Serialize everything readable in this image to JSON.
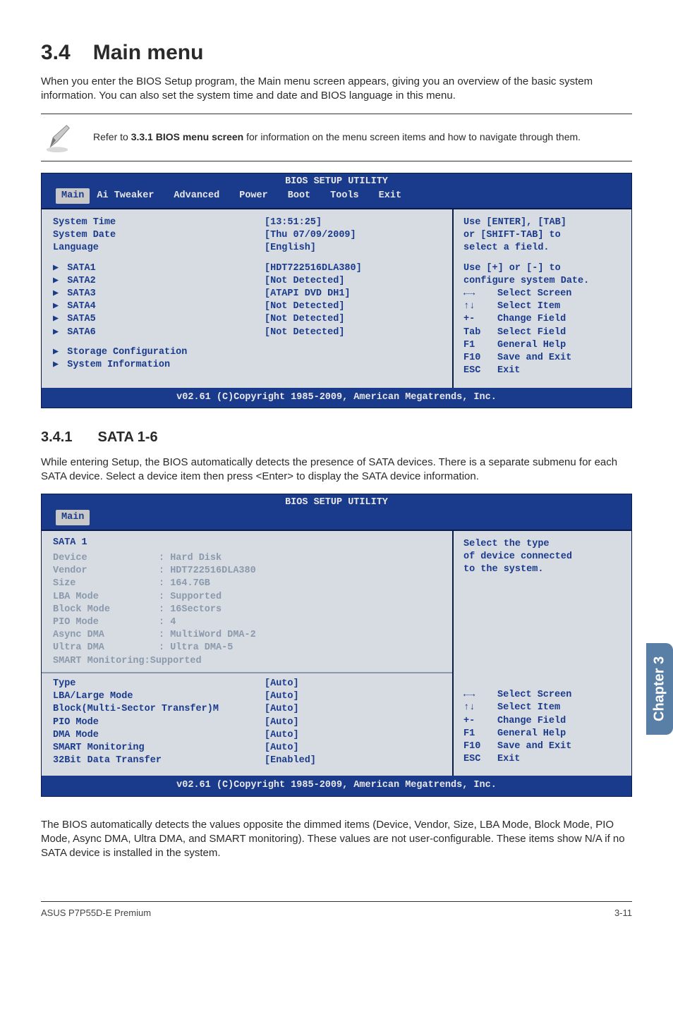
{
  "header": {
    "section_number": "3.4",
    "section_title": "Main menu",
    "intro": "When you enter the BIOS Setup program, the Main menu screen appears, giving you an overview of the basic system information. You can also set the system time and date and BIOS language in this menu.",
    "note_prefix": "Refer to ",
    "note_bold": "3.3.1 BIOS menu screen",
    "note_suffix": " for information on the menu screen items and how to navigate through them."
  },
  "bios1": {
    "title": "BIOS SETUP UTILITY",
    "tabs": [
      "Main",
      "Ai Tweaker",
      "Advanced",
      "Power",
      "Boot",
      "Tools",
      "Exit"
    ],
    "active_tab": "Main",
    "rows": [
      {
        "label": "System Time",
        "value": "[13:51:25]"
      },
      {
        "label": "System Date",
        "value": "[Thu 07/09/2009]"
      },
      {
        "label": "Language",
        "value": "[English]"
      }
    ],
    "sata_rows": [
      {
        "label": "SATA1",
        "value": "[HDT722516DLA380]"
      },
      {
        "label": "SATA2",
        "value": "[Not Detected]"
      },
      {
        "label": "SATA3",
        "value": "[ATAPI DVD DH1]"
      },
      {
        "label": "SATA4",
        "value": "[Not Detected]"
      },
      {
        "label": "SATA5",
        "value": "[Not Detected]"
      },
      {
        "label": "SATA6",
        "value": "[Not Detected]"
      }
    ],
    "submenus": [
      "Storage Configuration",
      "System Information"
    ],
    "help_top": [
      "Use [ENTER], [TAB]",
      "or [SHIFT-TAB] to",
      "select a field."
    ],
    "help_mid": [
      "Use [+] or [-] to",
      "configure system Date."
    ],
    "help_keys": [
      {
        "k": "←→",
        "d": "Select Screen"
      },
      {
        "k": "↑↓",
        "d": "Select Item"
      },
      {
        "k": "+-",
        "d": "Change Field"
      },
      {
        "k": "Tab",
        "d": "Select Field"
      },
      {
        "k": "F1",
        "d": "General Help"
      },
      {
        "k": "F10",
        "d": "Save and Exit"
      },
      {
        "k": "ESC",
        "d": "Exit"
      }
    ],
    "footer": "v02.61 (C)Copyright 1985-2009, American Megatrends, Inc."
  },
  "sub": {
    "section_number": "3.4.1",
    "section_title": "SATA 1-6",
    "intro": "While entering Setup, the BIOS automatically detects the presence of SATA devices. There is a separate submenu for each SATA device. Select a device item then press <Enter> to display the SATA device information."
  },
  "bios2": {
    "title": "BIOS SETUP UTILITY",
    "tabs": [
      "Main"
    ],
    "active_tab": "Main",
    "header": "SATA 1",
    "info_rows": [
      {
        "label": "Device",
        "value": ": Hard Disk"
      },
      {
        "label": "Vendor",
        "value": ": HDT722516DLA380"
      },
      {
        "label": "Size",
        "value": ": 164.7GB"
      },
      {
        "label": "LBA Mode",
        "value": ": Supported"
      },
      {
        "label": "Block Mode",
        "value": ": 16Sectors"
      },
      {
        "label": "PIO Mode",
        "value": ": 4"
      },
      {
        "label": "Async DMA",
        "value": ": MultiWord DMA-2"
      },
      {
        "label": "Ultra DMA",
        "value": ": Ultra DMA-5"
      },
      {
        "label": "SMART Monitoring",
        "value": ":Supported",
        "nowidth": true
      }
    ],
    "cfg_rows": [
      {
        "label": "Type",
        "value": "[Auto]"
      },
      {
        "label": "LBA/Large Mode",
        "value": "[Auto]"
      },
      {
        "label": "Block(Multi-Sector Transfer)M",
        "value": "[Auto]"
      },
      {
        "label": "PIO Mode",
        "value": "[Auto]"
      },
      {
        "label": "DMA Mode",
        "value": "[Auto]"
      },
      {
        "label": "SMART Monitoring",
        "value": "[Auto]"
      },
      {
        "label": "32Bit Data Transfer",
        "value": "[Enabled]"
      }
    ],
    "help_top": [
      "Select the type",
      "of device connected",
      "to the system."
    ],
    "help_keys": [
      {
        "k": "←→",
        "d": "Select Screen"
      },
      {
        "k": "↑↓",
        "d": "Select Item"
      },
      {
        "k": "+-",
        "d": "Change Field"
      },
      {
        "k": "F1",
        "d": "General Help"
      },
      {
        "k": "F10",
        "d": "Save and Exit"
      },
      {
        "k": "ESC",
        "d": "Exit"
      }
    ],
    "footer": "v02.61 (C)Copyright 1985-2009, American Megatrends, Inc."
  },
  "outro": "The BIOS automatically detects the values opposite the dimmed items (Device, Vendor, Size, LBA Mode, Block Mode, PIO Mode, Async DMA, Ultra DMA, and SMART monitoring). These values are not user-configurable. These items show N/A if no SATA device is installed in the system.",
  "side_tab": "Chapter 3",
  "footer": {
    "left": "ASUS P7P55D-E Premium",
    "right": "3-11"
  }
}
